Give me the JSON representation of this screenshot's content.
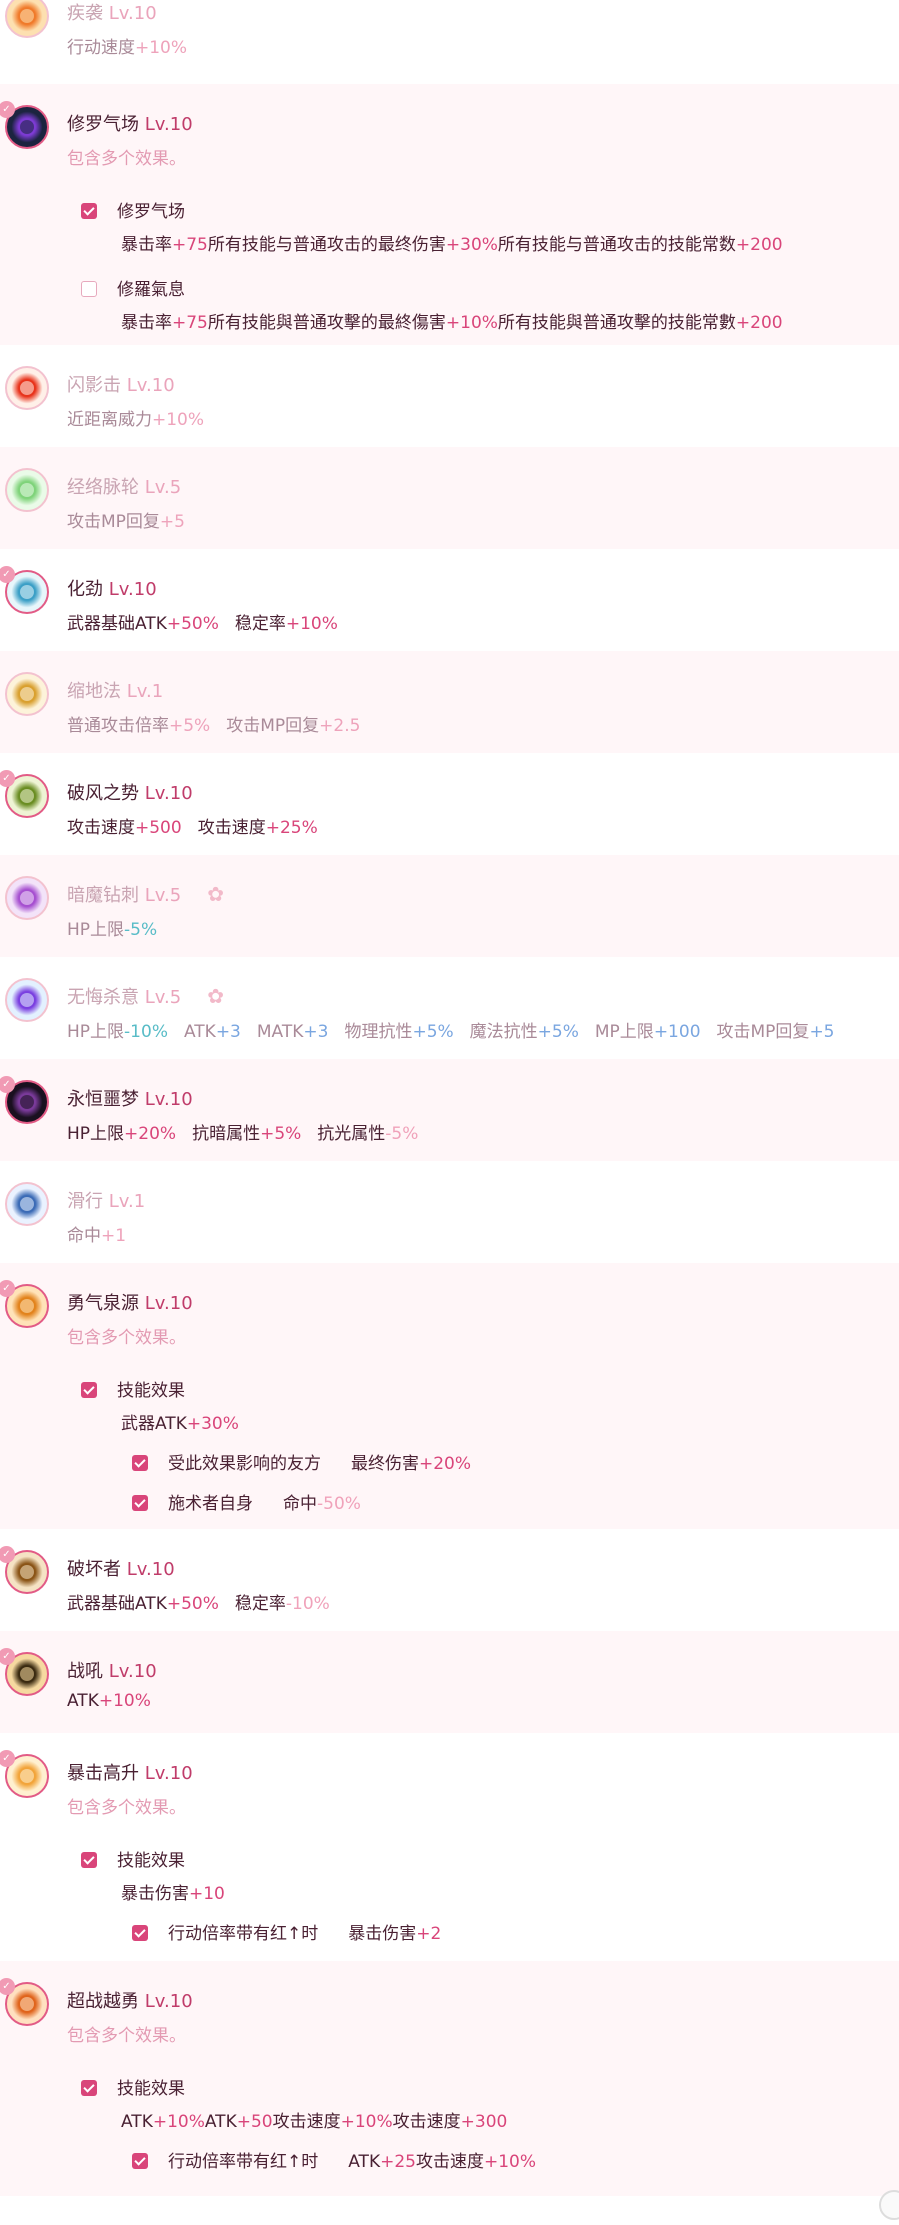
{
  "multi_effect_text": "包含多个效果。",
  "skills": [
    {
      "name": "疾袭",
      "level": "Lv.10",
      "active": false,
      "bg": "white",
      "stats": [
        {
          "label": "行动速度",
          "value": "+10%",
          "tone": "pos"
        }
      ]
    },
    {
      "name": "修罗气场",
      "level": "Lv.10",
      "active": true,
      "bg": "alt",
      "multi": true,
      "options": [
        {
          "label": "修罗气场",
          "checked": true,
          "stats": [
            {
              "label": "暴击率",
              "value": "+75",
              "tone": "pos"
            },
            {
              "label": "所有技能与普通攻击的最终伤害",
              "value": "+30%",
              "tone": "pos"
            },
            {
              "label": "所有技能与普通攻击的技能常数",
              "value": "+200",
              "tone": "pos"
            }
          ]
        },
        {
          "label": "修羅氣息",
          "checked": false,
          "stats": [
            {
              "label": "暴击率",
              "value": "+75",
              "tone": "pos"
            },
            {
              "label": "所有技能與普通攻擊的最終傷害",
              "value": "+10%",
              "tone": "pos"
            },
            {
              "label": "所有技能與普通攻擊的技能常數",
              "value": "+200",
              "tone": "pos"
            }
          ]
        }
      ]
    },
    {
      "name": "闪影击",
      "level": "Lv.10",
      "active": false,
      "bg": "white",
      "stats": [
        {
          "label": "近距离威力",
          "value": "+10%",
          "tone": "pos"
        }
      ]
    },
    {
      "name": "经络脉轮",
      "level": "Lv.5",
      "active": false,
      "bg": "alt",
      "stats": [
        {
          "label": "攻击MP回复",
          "value": "+5",
          "tone": "pos"
        }
      ]
    },
    {
      "name": "化劲",
      "level": "Lv.10",
      "active": true,
      "bg": "white",
      "stats": [
        {
          "label": "武器基础ATK",
          "value": "+50%",
          "tone": "pos"
        },
        {
          "label": "稳定率",
          "value": "+10%",
          "tone": "pos"
        }
      ]
    },
    {
      "name": "缩地法",
      "level": "Lv.1",
      "active": false,
      "bg": "alt",
      "stats": [
        {
          "label": "普通攻击倍率",
          "value": "+5%",
          "tone": "pos"
        },
        {
          "label": "攻击MP回复",
          "value": "+2.5",
          "tone": "pos"
        }
      ]
    },
    {
      "name": "破风之势",
      "level": "Lv.10",
      "active": true,
      "bg": "white",
      "stats": [
        {
          "label": "攻击速度",
          "value": "+500",
          "tone": "pos"
        },
        {
          "label": "攻击速度",
          "value": "+25%",
          "tone": "pos"
        }
      ]
    },
    {
      "name": "暗魔钻刺",
      "level": "Lv.5",
      "active": false,
      "bg": "alt",
      "gear": true,
      "stats": [
        {
          "label": "HP上限",
          "value": "-5%",
          "tone": "tl"
        }
      ]
    },
    {
      "name": "无悔杀意",
      "level": "Lv.5",
      "active": false,
      "bg": "white",
      "gear": true,
      "stats": [
        {
          "label": "HP上限",
          "value": "-10%",
          "tone": "tl"
        },
        {
          "label": "ATK",
          "value": "+3",
          "tone": "bl"
        },
        {
          "label": "MATK",
          "value": "+3",
          "tone": "bl"
        },
        {
          "label": "物理抗性",
          "value": "+5%",
          "tone": "bl"
        },
        {
          "label": "魔法抗性",
          "value": "+5%",
          "tone": "bl"
        },
        {
          "label": "MP上限",
          "value": "+100",
          "tone": "bl"
        },
        {
          "label": "攻击MP回复",
          "value": "+5",
          "tone": "bl"
        }
      ]
    },
    {
      "name": "永恒噩梦",
      "level": "Lv.10",
      "active": true,
      "bg": "alt",
      "stats": [
        {
          "label": "HP上限",
          "value": "+20%",
          "tone": "pos"
        },
        {
          "label": "抗暗属性",
          "value": "+5%",
          "tone": "pos"
        },
        {
          "label": "抗光属性",
          "value": "-5%",
          "tone": "neg"
        }
      ]
    },
    {
      "name": "滑行",
      "level": "Lv.1",
      "active": false,
      "bg": "white",
      "stats": [
        {
          "label": "命中",
          "value": "+1",
          "tone": "pos"
        }
      ]
    },
    {
      "name": "勇气泉源",
      "level": "Lv.10",
      "active": true,
      "bg": "alt",
      "multi": true,
      "options": [
        {
          "label": "技能效果",
          "checked": true,
          "stats": [
            {
              "label": "武器ATK",
              "value": "+30%",
              "tone": "pos"
            }
          ],
          "subs": [
            {
              "label": "受此效果影响的友方",
              "stats": [
                {
                  "label": "最终伤害",
                  "value": "+20%",
                  "tone": "pos"
                }
              ]
            },
            {
              "label": "施术者自身",
              "stats": [
                {
                  "label": "命中",
                  "value": "-50%",
                  "tone": "neg"
                }
              ]
            }
          ]
        }
      ]
    },
    {
      "name": "破坏者",
      "level": "Lv.10",
      "active": true,
      "bg": "white",
      "stats": [
        {
          "label": "武器基础ATK",
          "value": "+50%",
          "tone": "pos"
        },
        {
          "label": "稳定率",
          "value": "-10%",
          "tone": "neg"
        }
      ]
    },
    {
      "name": "战吼",
      "level": "Lv.10",
      "active": true,
      "bg": "alt",
      "stats": [
        {
          "label": "ATK",
          "value": "+10%",
          "tone": "pos"
        }
      ]
    },
    {
      "name": "暴击高升",
      "level": "Lv.10",
      "active": true,
      "bg": "white",
      "multi": true,
      "options": [
        {
          "label": "技能效果",
          "checked": true,
          "stats": [
            {
              "label": "暴击伤害",
              "value": "+10",
              "tone": "pos"
            }
          ],
          "subs": [
            {
              "label": "行动倍率带有红↑时",
              "stats": [
                {
                  "label": "暴击伤害",
                  "value": "+2",
                  "tone": "pos"
                }
              ]
            }
          ]
        }
      ]
    },
    {
      "name": "超战越勇",
      "level": "Lv.10",
      "active": true,
      "bg": "alt",
      "multi": true,
      "options": [
        {
          "label": "技能效果",
          "checked": true,
          "stats": [
            {
              "label": "ATK",
              "value": "+10%",
              "tone": "pos"
            },
            {
              "label": "ATK",
              "value": "+50",
              "tone": "pos"
            },
            {
              "label": "攻击速度",
              "value": "+10%",
              "tone": "pos"
            },
            {
              "label": "攻击速度",
              "value": "+300",
              "tone": "pos"
            }
          ],
          "subs": [
            {
              "label": "行动倍率带有红↑时",
              "stats": [
                {
                  "label": "ATK",
                  "value": "+25",
                  "tone": "pos"
                },
                {
                  "label": "攻击速度",
                  "value": "+10%",
                  "tone": "pos"
                }
              ]
            }
          ]
        }
      ]
    }
  ],
  "icons": [
    "flame-burst-icon",
    "asura-aura-icon",
    "shadow-strike-icon",
    "chakra-figure-icon",
    "energy-fist-icon",
    "shrink-step-icon",
    "wind-stance-icon",
    "dark-drill-icon",
    "heart-orb-icon",
    "nightmare-eye-icon",
    "sliding-figure-icon",
    "fire-lion-icon",
    "bronze-shield-icon",
    "war-cry-icon",
    "crit-burst-icon",
    "flame-beast-icon"
  ]
}
